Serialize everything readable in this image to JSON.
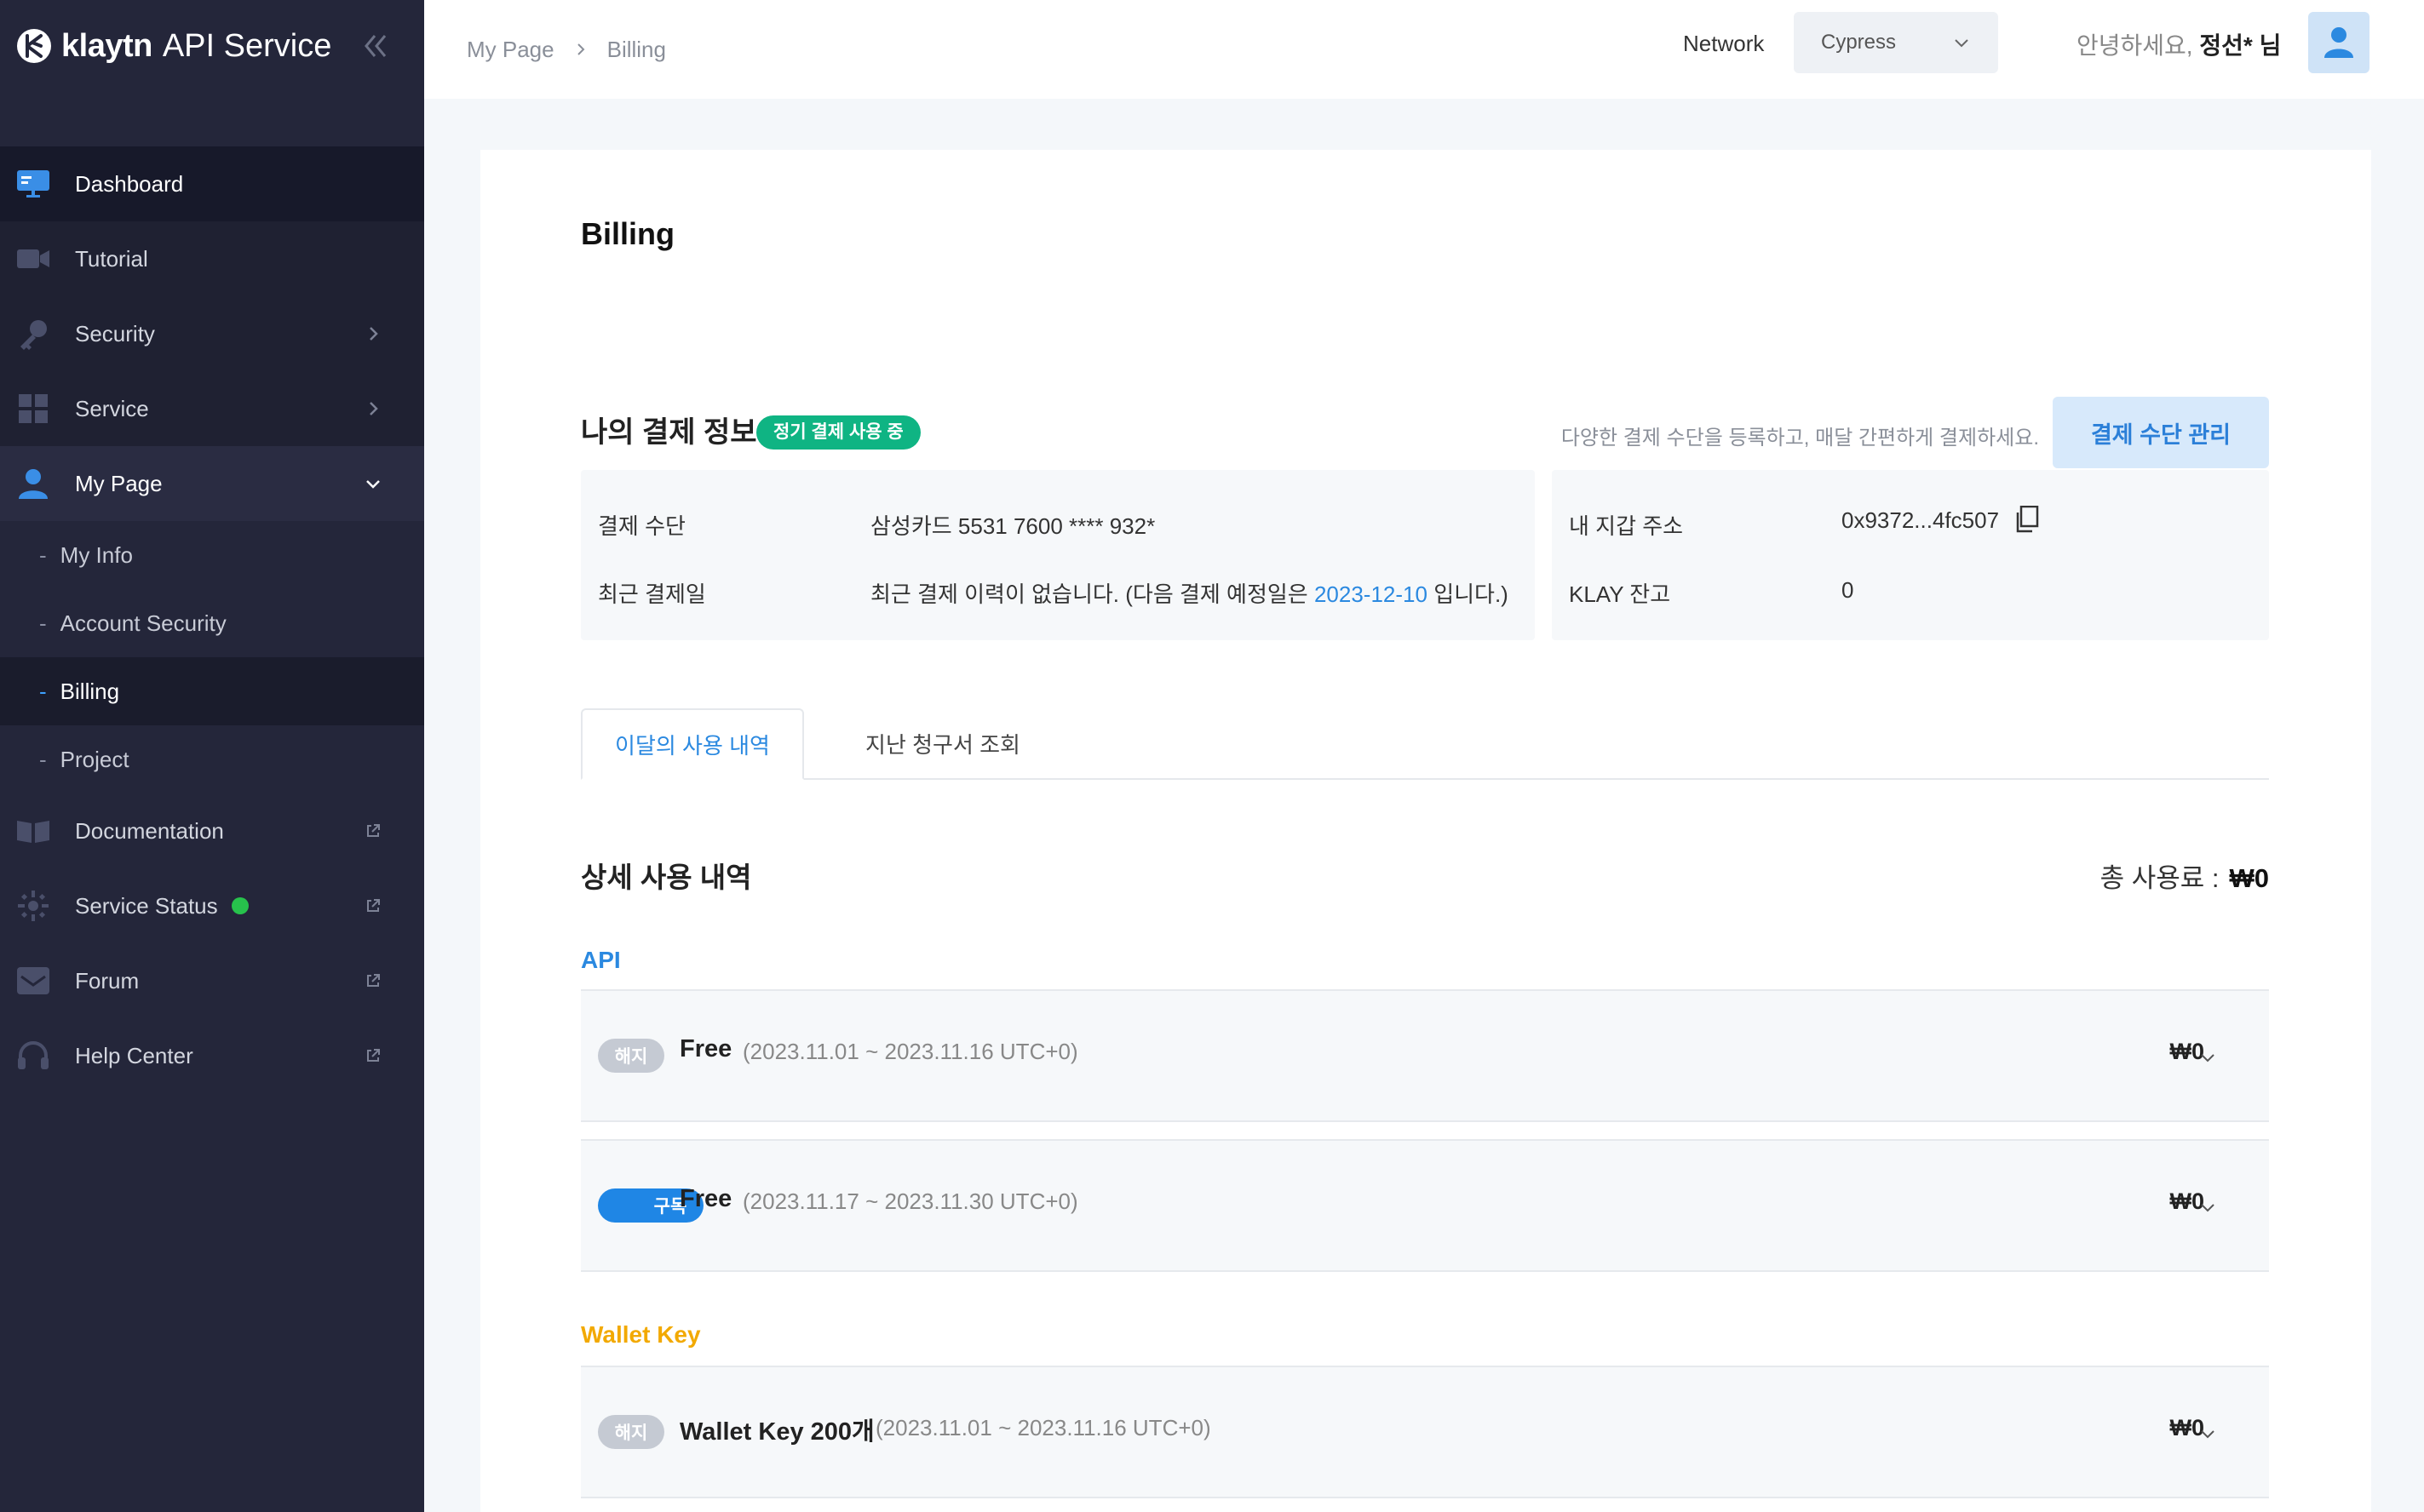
{
  "app": {
    "brand": "klaytn",
    "brand_sub": "API Service"
  },
  "sidebar": {
    "items": [
      {
        "label": "Dashboard",
        "icon": "monitor-icon"
      },
      {
        "label": "Tutorial",
        "icon": "video-icon"
      },
      {
        "label": "Security",
        "icon": "key-icon"
      },
      {
        "label": "Service",
        "icon": "grid-icon"
      },
      {
        "label": "My Page",
        "icon": "user-icon"
      },
      {
        "label": "Documentation",
        "icon": "book-icon"
      },
      {
        "label": "Service Status",
        "icon": "gear-icon"
      },
      {
        "label": "Forum",
        "icon": "inbox-icon"
      },
      {
        "label": "Help Center",
        "icon": "headset-icon"
      }
    ],
    "sub_items": [
      "My Info",
      "Account Security",
      "Billing",
      "Project"
    ],
    "status_color": "#27c24c"
  },
  "header": {
    "breadcrumb": [
      "My Page",
      "Billing"
    ],
    "network_label": "Network",
    "network_value": "Cypress",
    "greeting": "안녕하세요,",
    "user_name": "정선* 님"
  },
  "main": {
    "title": "Billing",
    "payment": {
      "title": "나의 결제 정보",
      "badge": "정기 결제 사용 중",
      "hint": "다양한 결제 수단을 등록하고, 매달 간편하게 결제하세요.",
      "button": "결제 수단 관리",
      "method_key": "결제 수단",
      "method_value": "삼성카드 5531 7600 **** 932*",
      "recent_key": "최근 결제일",
      "recent_prefix": "최근 결제 이력이 없습니다. (다음 결제 예정일은",
      "recent_date": "2023-12-10",
      "recent_suffix": "입니다.)",
      "wallet_key": "내 지갑 주소",
      "wallet_value": "0x9372...4fc507",
      "klay_key": "KLAY 잔고",
      "klay_value": "0"
    },
    "tabs": [
      "이달의 사용 내역",
      "지난 청구서 조회"
    ],
    "detail": {
      "title": "상세 사용 내역",
      "total_label": "총 사용료 :",
      "total_value": "₩0"
    },
    "sections": {
      "api": "API",
      "wallet": "Wallet Key"
    },
    "usage": [
      {
        "status": "해지",
        "plan": "Free",
        "period": "(2023.11.01 ~ 2023.11.16 UTC+0)",
        "price": "₩0"
      },
      {
        "status": "구독",
        "plan": "Free",
        "period": "(2023.11.17 ~ 2023.11.30 UTC+0)",
        "price": "₩0"
      },
      {
        "status": "해지",
        "plan": "Wallet Key 200개",
        "period": "(2023.11.01 ~ 2023.11.16 UTC+0)",
        "price": "₩0"
      }
    ]
  }
}
